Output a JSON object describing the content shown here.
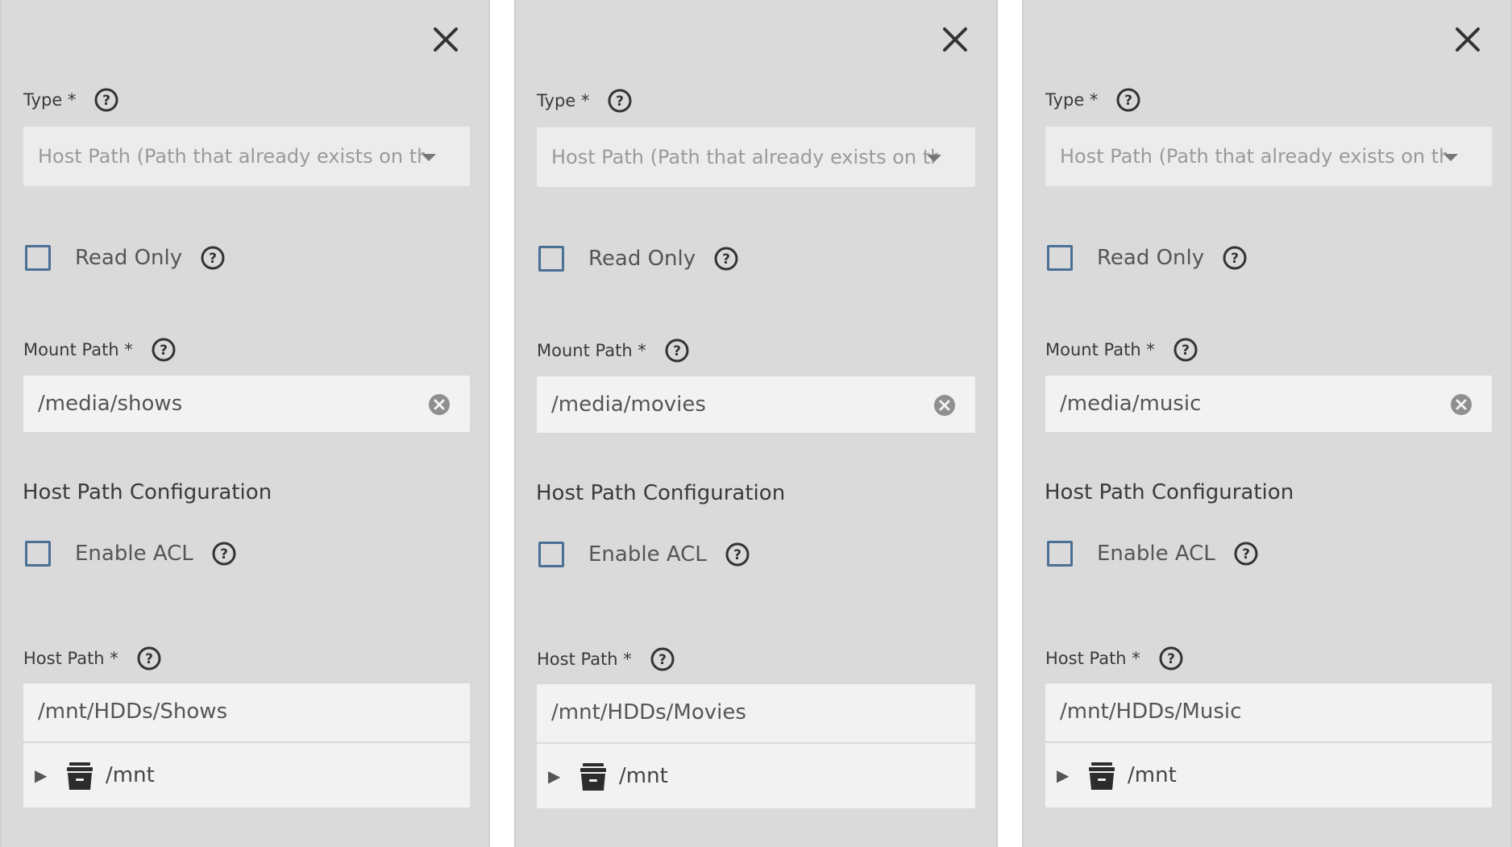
{
  "panels": [
    {
      "type_label": "Type *",
      "type_value": "Host Path (Path that already exists on the system)",
      "read_only_label": "Read Only",
      "mount_path_label": "Mount Path *",
      "mount_path_value": "/media/shows",
      "section_heading": "Host Path Configuration",
      "enable_acl_label": "Enable ACL",
      "host_path_label": "Host Path *",
      "host_path_value": "/mnt/HDDs/Shows",
      "tree_root_label": "/mnt"
    },
    {
      "type_label": "Type *",
      "type_value": "Host Path (Path that already exists on the system)",
      "read_only_label": "Read Only",
      "mount_path_label": "Mount Path *",
      "mount_path_value": "/media/movies",
      "section_heading": "Host Path Configuration",
      "enable_acl_label": "Enable ACL",
      "host_path_label": "Host Path *",
      "host_path_value": "/mnt/HDDs/Movies",
      "tree_root_label": "/mnt"
    },
    {
      "type_label": "Type *",
      "type_value": "Host Path (Path that already exists on the system)",
      "read_only_label": "Read Only",
      "mount_path_label": "Mount Path *",
      "mount_path_value": "/media/music",
      "section_heading": "Host Path Configuration",
      "enable_acl_label": "Enable ACL",
      "host_path_label": "Host Path *",
      "host_path_value": "/mnt/HDDs/Music",
      "tree_root_label": "/mnt"
    }
  ],
  "icons": {
    "close": "close-icon",
    "help": "help-icon",
    "clear": "clear-icon",
    "expand": "expand-arrow-icon",
    "dataset": "dataset-icon"
  },
  "colors": {
    "panel_bg": "#dadada",
    "input_bg": "#f2f2f2",
    "checkbox_border": "#4a7194",
    "text": "#3a3a3a"
  }
}
